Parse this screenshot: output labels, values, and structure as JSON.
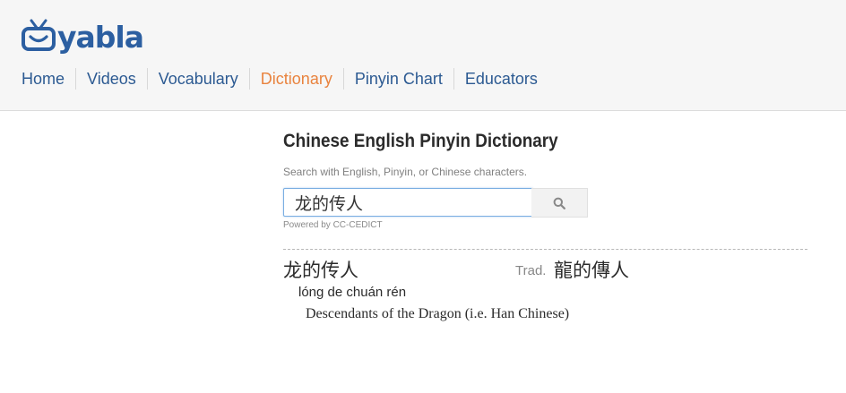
{
  "logo": {
    "text": "yabla",
    "color": "#2c5fa1"
  },
  "nav": {
    "items": [
      {
        "label": "Home",
        "active": false
      },
      {
        "label": "Videos",
        "active": false
      },
      {
        "label": "Vocabulary",
        "active": false
      },
      {
        "label": "Dictionary",
        "active": true
      },
      {
        "label": "Pinyin Chart",
        "active": false
      },
      {
        "label": "Educators",
        "active": false
      }
    ],
    "active_color": "#e9833e"
  },
  "main": {
    "title": "Chinese English Pinyin Dictionary",
    "hint": "Search with English, Pinyin, or Chinese characters.",
    "search": {
      "value": "龙的传人",
      "button_icon": "search-icon"
    },
    "powered_by": "Powered by CC-CEDICT"
  },
  "entry": {
    "simplified": "龙的传人",
    "trad_label": "Trad.",
    "traditional": "龍的傳人",
    "pinyin": "lóng de chuán rén",
    "definition": "Descendants of the Dragon (i.e. Han Chinese)"
  }
}
